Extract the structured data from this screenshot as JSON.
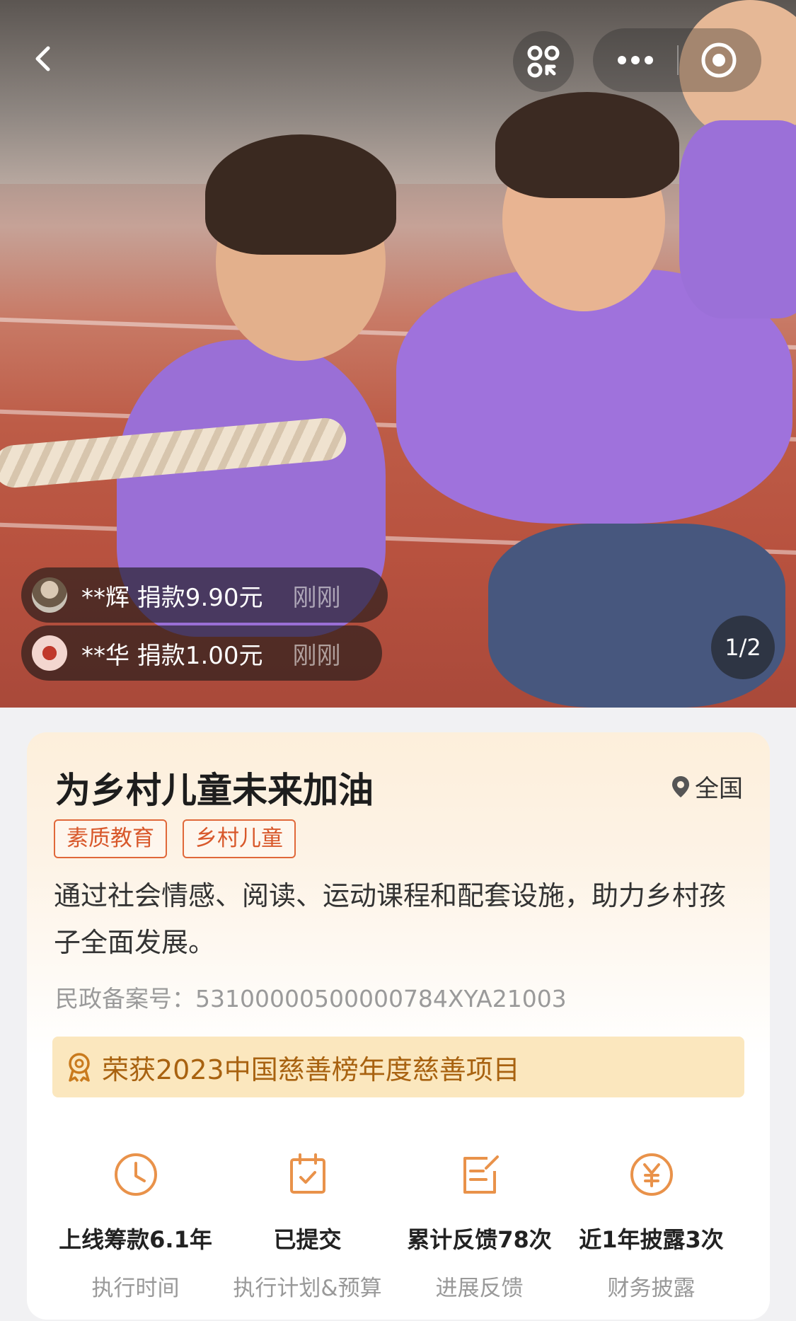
{
  "hero": {
    "pager": "1/2",
    "donations": [
      {
        "text": "**辉 捐款9.90元",
        "time": "刚刚"
      },
      {
        "text": "**华 捐款1.00元",
        "time": "刚刚"
      }
    ]
  },
  "project": {
    "title": "为乡村儿童未来加油",
    "location": "全国",
    "tags": [
      "素质教育",
      "乡村儿童"
    ],
    "description": "通过社会情感、阅读、运动课程和配套设施，助力乡村孩子全面发展。",
    "record_no": "民政备案号：53100000500000784XYA21003",
    "award": "荣获2023中国慈善榜年度慈善项目"
  },
  "stats": [
    {
      "icon": "clock-icon",
      "value": "上线筹款6.1年",
      "label": "执行时间"
    },
    {
      "icon": "calendar-check-icon",
      "value": "已提交",
      "label": "执行计划&预算"
    },
    {
      "icon": "feedback-icon",
      "value": "累计反馈78次",
      "label": "进展反馈"
    },
    {
      "icon": "yuan-icon",
      "value": "近1年披露3次",
      "label": "财务披露"
    }
  ],
  "colors": {
    "accent": "#e0683a",
    "award_bg": "#fbe7be",
    "award_text": "#a86210",
    "icon_orange": "#e9924a"
  }
}
